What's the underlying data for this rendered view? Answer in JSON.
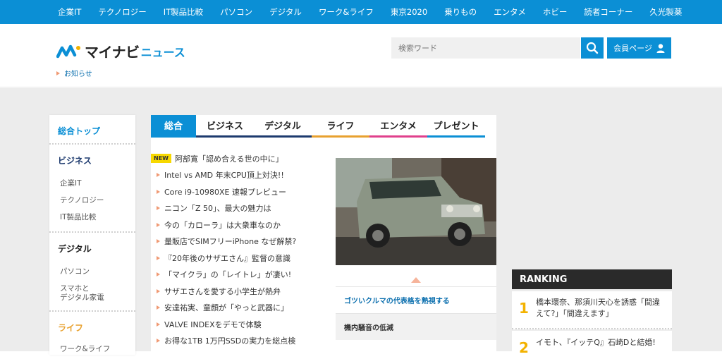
{
  "topnav": [
    "企業IT",
    "テクノロジー",
    "IT製品比較",
    "パソコン",
    "デジタル",
    "ワーク&ライフ",
    "東京2020",
    "乗りもの",
    "エンタメ",
    "ホビー",
    "読者コーナー",
    "久光製薬"
  ],
  "logo": {
    "text": "マイナビ",
    "sub": "ニュース"
  },
  "notice": "お知らせ",
  "search": {
    "placeholder": "検索ワード"
  },
  "member_label": "会員ページ",
  "sidebar": {
    "top": "総合トップ",
    "business": {
      "head": "ビジネス",
      "items": [
        "企業IT",
        "テクノロジー",
        "IT製品比較"
      ]
    },
    "digital": {
      "head": "デジタル",
      "items": [
        "パソコン",
        "スマホと",
        "デジタル家電"
      ]
    },
    "life": {
      "head": "ライフ",
      "items": [
        "ワーク&ライフ"
      ]
    }
  },
  "tabs": [
    {
      "label": "総合",
      "color": "#0b8fd5"
    },
    {
      "label": "ビジネス",
      "color": "#1d3a6e"
    },
    {
      "label": "デジタル",
      "color": "#1d3a6e"
    },
    {
      "label": "ライフ",
      "color": "#e8a12f"
    },
    {
      "label": "エンタメ",
      "color": "#e0408c"
    },
    {
      "label": "プレゼント",
      "color": "#0b8fd5"
    }
  ],
  "new_badge": "NEW",
  "news": [
    "阿部寛「認め合える世の中に」",
    "Intel vs AMD 年末CPU頂上対決!!",
    "Core i9-10980XE 速報プレビュー",
    "ニコン「Z 50」、最大の魅力は",
    "今の「カローラ」は大衆車なのか",
    "量販店でSIMフリーiPhone なぜ解禁?",
    "『20年後のサザエさん』監督の意識",
    "「マイクラ」の「レイトレ」が凄い!",
    "サザエさんを愛する小学生が熱弁",
    "安達祐実、童顔が「やっと武器に」",
    "VALVE INDEXをデモで体験",
    "お得な1TB 1万円SSDの実力を総点検"
  ],
  "features": [
    "ゴツいクルマの代表格を熟視する",
    "機内騒音の低減"
  ],
  "ranking": {
    "title": "RANKING",
    "items": [
      {
        "num": "1",
        "line1": "橋本環奈、那須川天心を誘惑「間違",
        "line2": "えて?」「間違えます」"
      },
      {
        "num": "2",
        "line1": "イモト、『イッテQ』石崎Dと結婚!",
        "line2": ""
      }
    ]
  },
  "colors": {
    "brand": "#0b8fd5",
    "accent": "#f3b200"
  }
}
